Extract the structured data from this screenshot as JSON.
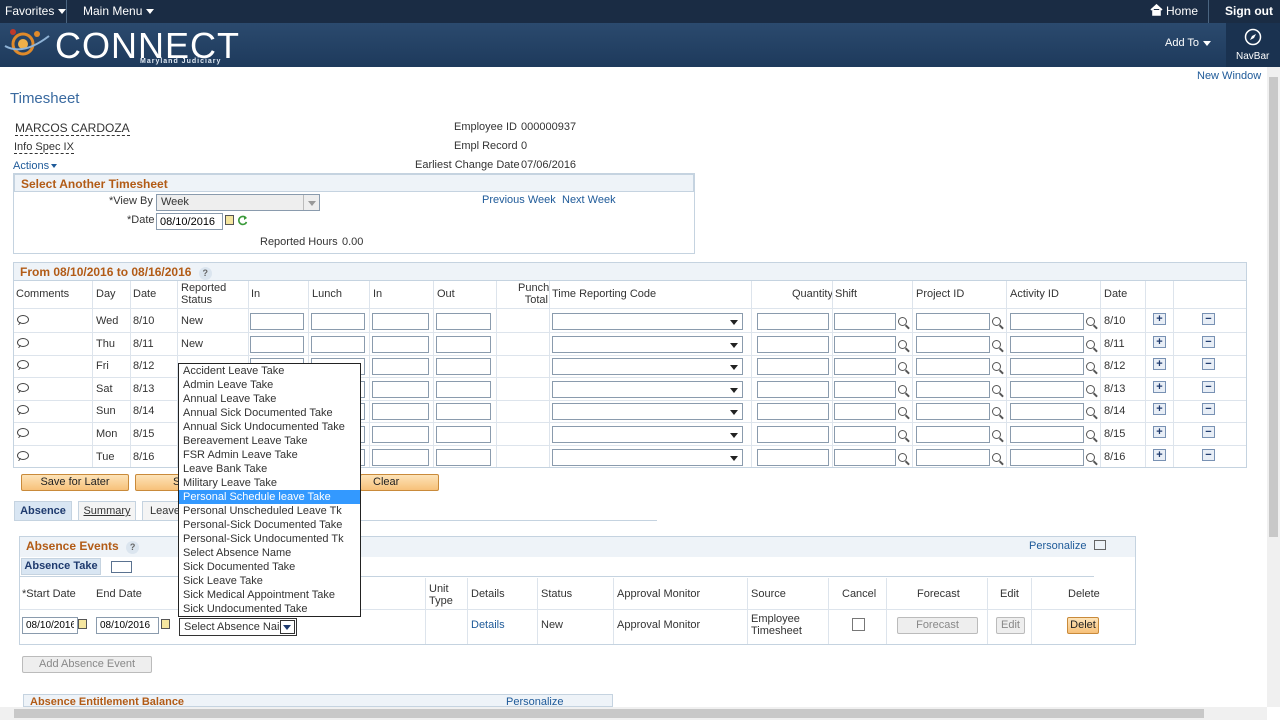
{
  "topbar": {
    "favorites": "Favorites",
    "main_menu": "Main Menu",
    "home": "Home",
    "sign_out": "Sign out"
  },
  "banner": {
    "logo": "CONNECT",
    "logo_sub": "Maryland Judiciary",
    "add_to": "Add To",
    "navbar": "NavBar"
  },
  "page": {
    "new_window": "New Window",
    "title": "Timesheet"
  },
  "employee": {
    "name": "MARCOS CARDOZA",
    "job": "Info Spec IX",
    "actions": "Actions",
    "id_label": "Employee ID",
    "id_value": "000000937",
    "rec_label": "Empl Record",
    "rec_value": "0",
    "ecd_label": "Earliest Change Date",
    "ecd_value": "07/06/2016"
  },
  "select_ts": {
    "header": "Select Another Timesheet",
    "view_by_label": "*View By",
    "view_by_value": "Week",
    "date_label": "*Date",
    "date_value": "08/10/2016",
    "prev_week": "Previous Week",
    "next_week": "Next Week",
    "reported_hours_label": "Reported Hours",
    "reported_hours_value": "0.00"
  },
  "grid": {
    "header": "From 08/10/2016 to 08/16/2016",
    "columns": [
      "Comments",
      "Day",
      "Date",
      "Reported Status",
      "In",
      "Lunch",
      "In",
      "Out",
      "Punch Total",
      "Time Reporting Code",
      "Quantity",
      "Shift",
      "Project ID",
      "Activity ID",
      "Date"
    ],
    "rows": [
      {
        "day": "Wed",
        "date": "8/10",
        "status": "New",
        "date2": "8/10"
      },
      {
        "day": "Thu",
        "date": "8/11",
        "status": "New",
        "date2": "8/11"
      },
      {
        "day": "Fri",
        "date": "8/12",
        "status": "",
        "date2": "8/12"
      },
      {
        "day": "Sat",
        "date": "8/13",
        "status": "",
        "date2": "8/13"
      },
      {
        "day": "Sun",
        "date": "8/14",
        "status": "",
        "date2": "8/14"
      },
      {
        "day": "Mon",
        "date": "8/15",
        "status": "",
        "date2": "8/15"
      },
      {
        "day": "Tue",
        "date": "8/16",
        "status": "",
        "date2": "8/16"
      }
    ]
  },
  "buttons": {
    "save_later": "Save for Later",
    "submit_partial": "S",
    "clear": "Clear"
  },
  "tabs": {
    "absence": "Absence",
    "summary": "Summary",
    "leave": "Leave"
  },
  "absence": {
    "header": "Absence Events",
    "personalize": "Personalize",
    "subtab": "Absence Take",
    "cols": {
      "start": "*Start Date",
      "end": "End Date",
      "unit_type": "Unit Type",
      "details": "Details",
      "status": "Status",
      "approval": "Approval Monitor",
      "source": "Source",
      "cancel": "Cancel",
      "forecast": "Forecast",
      "edit": "Edit",
      "delete": "Delete"
    },
    "row": {
      "start": "08/10/2016",
      "end": "08/10/2016",
      "absence_name": "Select Absence Nai",
      "details": "Details",
      "status": "New",
      "approval": "Approval Monitor",
      "source": "Employee Timesheet",
      "forecast_btn": "Forecast",
      "edit_btn": "Edit",
      "delete_btn": "Delet"
    },
    "add_button": "Add Absence Event",
    "entitlement_header": "Absence Entitlement Balance",
    "entitlement_personalize": "Personalize"
  },
  "dropdown": {
    "options": [
      "Accident Leave Take",
      "Admin Leave Take",
      "Annual Leave Take",
      "Annual Sick Documented Take",
      "Annual Sick Undocumented Take",
      "Bereavement Leave Take",
      "FSR Admin Leave Take",
      "Leave Bank Take",
      "Military Leave Take",
      "Personal Schedule leave Take",
      "Personal Unscheduled Leave Tk",
      "Personal-Sick Documented Take",
      "Personal-Sick Undocumented Tk",
      "Select Absence Name",
      "Sick Documented Take",
      "Sick Leave Take",
      "Sick Medical Appointment Take",
      "Sick Undocumented Take"
    ],
    "highlighted": "Personal Schedule leave Take"
  }
}
